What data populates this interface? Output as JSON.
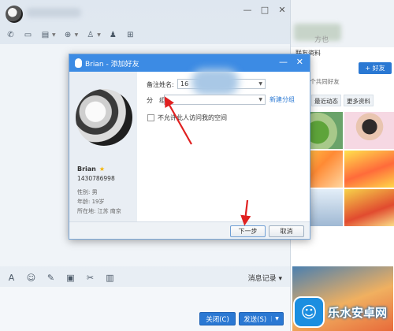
{
  "chat": {
    "window_controls": [
      "—",
      "□",
      "✕"
    ],
    "toolbar_icons": [
      "phone-icon",
      "video-icon",
      "folder-icon",
      "apps-icon",
      "invite-icon",
      "group-icon",
      "share-screen-icon"
    ],
    "input_toolbar_icons": [
      "font-icon",
      "emoji-icon",
      "shake-icon",
      "image-icon",
      "scissors-icon",
      "clipboard-icon"
    ],
    "message_record_label": "消息记录",
    "close_label": "关闭(C)",
    "send_label": "发送(S)"
  },
  "right_panel": {
    "top_name": "方也",
    "friend_info_title": "联友资料",
    "add_friend_label": "+ 好友",
    "mutual_text": "岁 685个共同好友",
    "tabs": [
      "照片",
      "最近动态",
      "更多资料"
    ],
    "active_tab": "照片"
  },
  "dialog": {
    "title": "Brian - 添加好友",
    "remark_label": "备注姓名:",
    "remark_value": "16",
    "group_label": "分　组:",
    "new_group_label": "新建分组",
    "checkbox_label": "不允许此人访问我的空间",
    "checkbox_checked": false,
    "next_label": "下一步",
    "cancel_label": "取消",
    "profile": {
      "name": "Brian",
      "id": "1430786998",
      "gender": "性别: 男",
      "age": "年龄: 19岁",
      "location": "所在地: 江苏 南京"
    }
  },
  "watermark": {
    "text": "乐水安卓网"
  },
  "accent_colors": {
    "primary_blue": "#2a78d3",
    "title_blue": "#3c8be4",
    "arrow_red": "#e02020"
  }
}
